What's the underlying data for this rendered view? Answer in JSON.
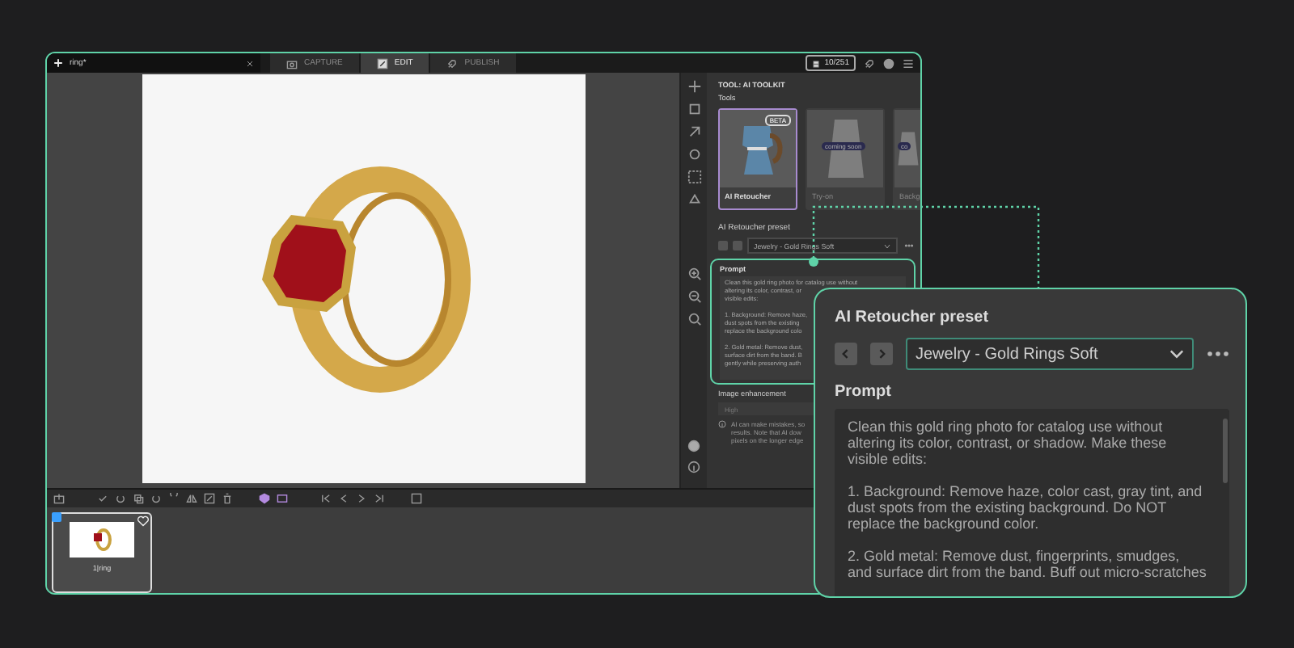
{
  "editor_tab": {
    "title": "ring*"
  },
  "mode_tabs": [
    {
      "label": "CAPTURE",
      "selected": false
    },
    {
      "label": "EDIT",
      "selected": true
    },
    {
      "label": "PUBLISH",
      "selected": false
    }
  ],
  "credits": "10/251",
  "panel": {
    "heading": "TOOL: AI TOOLKIT",
    "tools_label": "Tools",
    "tools": [
      {
        "label": "AI Retoucher",
        "badge": "BETA",
        "selected": true
      },
      {
        "label": "Try-on",
        "badge": "coming soon",
        "selected": false
      },
      {
        "label": "Backg",
        "badge": "co",
        "selected": false
      }
    ],
    "preset_label": "AI Retoucher preset",
    "preset_value": "Jewelry - Gold Rings Soft",
    "prompt_label": "Prompt",
    "prompt_paragraphs": [
      [
        "Clean this gold ring photo for catalog use without",
        "altering its color, contrast, or",
        "visible edits:"
      ],
      [
        "1. Background: Remove haze,",
        "dust spots from the existing",
        "replace the background colo"
      ],
      [
        "2. Gold metal: Remove dust,",
        "surface dirt from the band. B",
        "gently while preserving auth"
      ]
    ],
    "enhancement_label": "Image enhancement",
    "enhancement_value": "High",
    "note_lines": [
      "AI can make mistakes, so",
      "results. Note that AI dow",
      "pixels on the longer edge"
    ]
  },
  "filmstrip": [
    {
      "label": "1|ring",
      "selected": true
    }
  ],
  "callout": {
    "preset_label": "AI Retoucher preset",
    "preset_value": "Jewelry - Gold Rings Soft",
    "prompt_label": "Prompt",
    "prompt": "Clean this gold ring photo for catalog use without altering its color, contrast, or shadow. Make these visible edits:\n\n1. Background: Remove haze, color cast, gray tint, and dust spots from the existing background. Do NOT replace the background color.\n\n2. Gold metal: Remove dust, fingerprints, smudges, and surface dirt from the band. Buff out micro-scratches"
  }
}
